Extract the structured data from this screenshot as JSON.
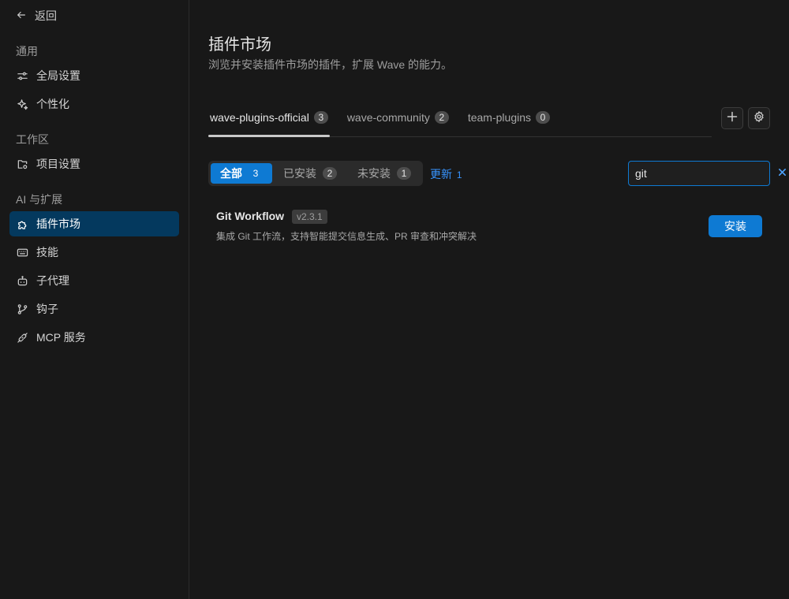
{
  "sidebar": {
    "back_label": "返回",
    "sections": [
      {
        "label": "通用"
      },
      {
        "label": "工作区"
      },
      {
        "label": "AI 与扩展"
      }
    ],
    "items": [
      {
        "label": "全局设置",
        "icon": "sliders-icon"
      },
      {
        "label": "个性化",
        "icon": "sparkle-icon"
      },
      {
        "label": "项目设置",
        "icon": "folder-gear-icon"
      },
      {
        "label": "插件市场",
        "icon": "puzzle-icon",
        "active": true
      },
      {
        "label": "技能",
        "icon": "keyboard-icon"
      },
      {
        "label": "子代理",
        "icon": "robot-icon"
      },
      {
        "label": "钩子",
        "icon": "git-branch-icon"
      },
      {
        "label": "MCP 服务",
        "icon": "plug-icon"
      }
    ]
  },
  "main": {
    "title": "插件市场",
    "subtitle": "浏览并安装插件市场的插件，扩展 Wave 的能力。",
    "tabs": [
      {
        "label": "wave-plugins-official",
        "count": "3",
        "active": true
      },
      {
        "label": "wave-community",
        "count": "2"
      },
      {
        "label": "team-plugins",
        "count": "0"
      }
    ],
    "filters": [
      {
        "label": "全部",
        "count": "3",
        "active": true
      },
      {
        "label": "已安装",
        "count": "2"
      },
      {
        "label": "未安装",
        "count": "1"
      }
    ],
    "update": {
      "label": "更新",
      "count": "1"
    },
    "search": {
      "value": "git",
      "placeholder": ""
    },
    "plugins": [
      {
        "name": "Git Workflow",
        "version": "v2.3.1",
        "description": "集成 Git 工作流，支持智能提交信息生成、PR 审查和冲突解决",
        "action": "安装"
      }
    ]
  },
  "colors": {
    "background": "#181818",
    "accent": "#0e7ad3",
    "active_nav": "#04395e",
    "link": "#3794ff"
  }
}
